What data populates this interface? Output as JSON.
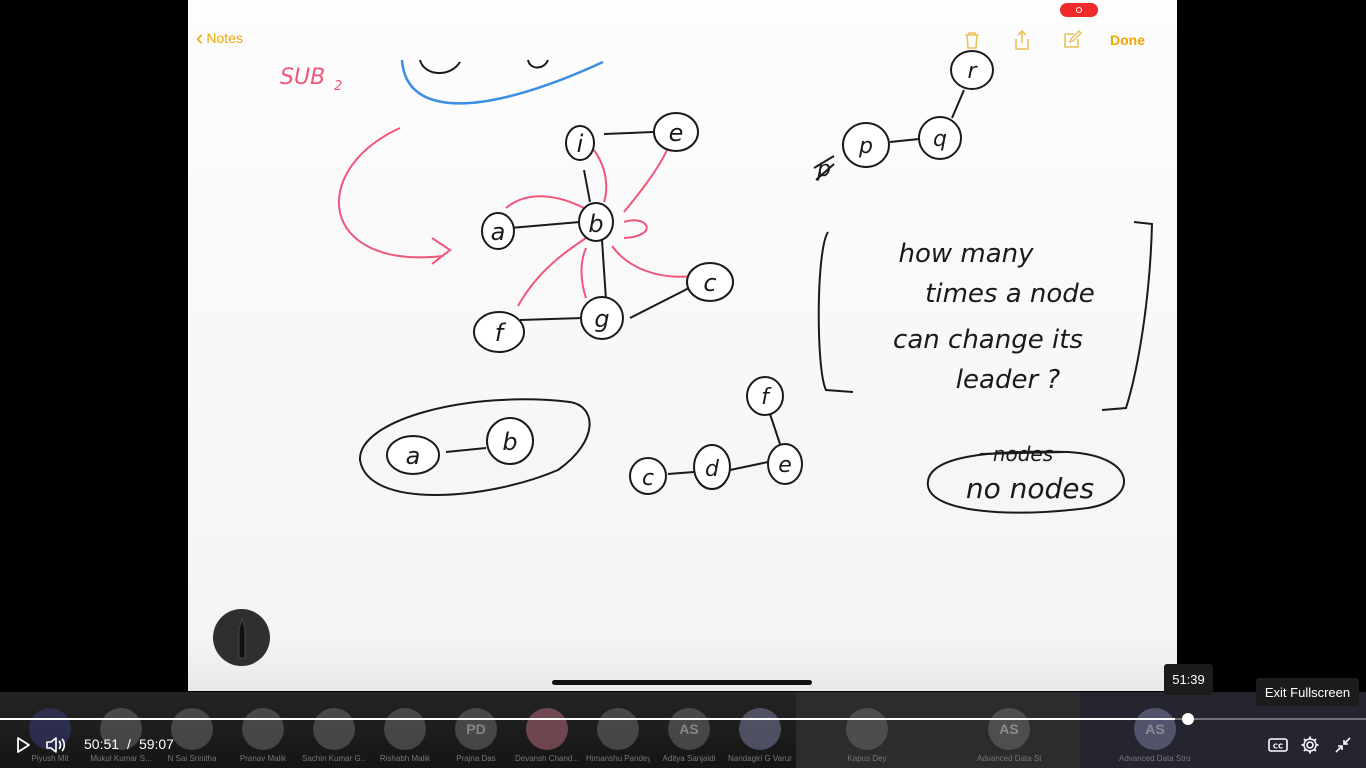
{
  "notes": {
    "back_label": "Notes",
    "done_label": "Done",
    "icons": [
      "trash-icon",
      "share-icon",
      "compose-icon"
    ]
  },
  "handwriting": {
    "sub_label": "SUB2",
    "question_lines": [
      "how many",
      "times a node",
      "can change its",
      "leader ?"
    ],
    "answer": "no nodes",
    "struck": "nodes"
  },
  "player": {
    "current_time": "50:51",
    "separator": "/",
    "duration": "59:07",
    "progress_fraction": 0.86,
    "hover_time": "51:39",
    "hover_fraction": 0.87,
    "exit_fullscreen_tooltip": "Exit Fullscreen"
  },
  "participants": [
    {
      "initials": "",
      "name": "Piyush Mit"
    },
    {
      "initials": "",
      "name": "Mukul Kumar S..."
    },
    {
      "initials": "",
      "name": "N Sai Srinitha"
    },
    {
      "initials": "",
      "name": "Pranav Malik"
    },
    {
      "initials": "",
      "name": "Sachin Kumar G..."
    },
    {
      "initials": "",
      "name": "Rishabh Malik"
    },
    {
      "initials": "PD",
      "name": "Prajna Das"
    },
    {
      "initials": "",
      "name": "Devansh Chand..."
    },
    {
      "initials": "",
      "name": "Himanshu Pandey"
    },
    {
      "initials": "AS",
      "name": "Aditya Sanjaidi"
    },
    {
      "initials": "",
      "name": "Nandagiri G Varun"
    },
    {
      "initials": "",
      "name": "Kapus Dey"
    },
    {
      "initials": "AS",
      "name": "Advanced Data Structures & Algorit..."
    },
    {
      "initials": "AS",
      "name": "Advanced Data Structures & Algorit..."
    }
  ],
  "colors": {
    "ink_black": "#1a1a1a",
    "ink_pink": "#f0577a",
    "ink_blue": "#3b8fe0",
    "accent_yellow": "#e9a700"
  }
}
